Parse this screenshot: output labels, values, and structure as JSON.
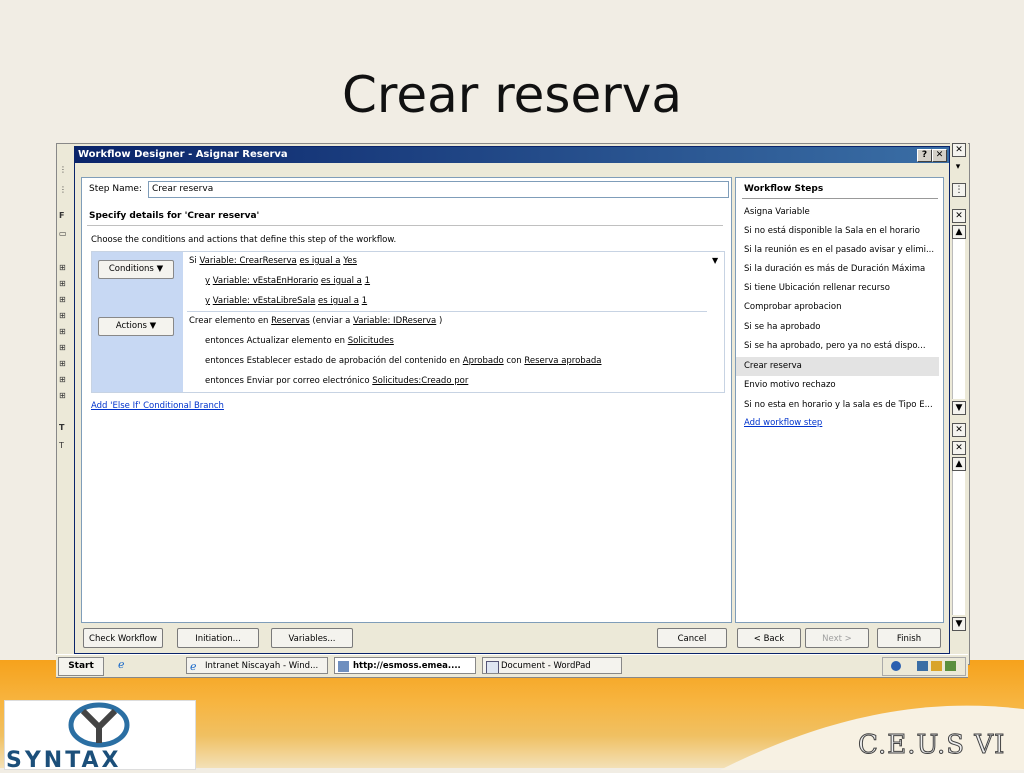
{
  "slide": {
    "title": "Crear reserva"
  },
  "dialog": {
    "title": "Workflow Designer - Asignar Reserva",
    "help_btn": "?",
    "close_btn": "✕",
    "step_name_label": "Step Name:",
    "step_name_value": "Crear reserva",
    "section_heading": "Specify details for 'Crear reserva'",
    "instructions": "Choose the conditions and actions that define this step of the workflow.",
    "conditions_btn": "Conditions ▼",
    "actions_btn": "Actions ▼",
    "conditions": [
      {
        "prefix": "Si ",
        "var": "Variable: CrearReserva",
        "op": "es igual a",
        "val": "Yes"
      },
      {
        "prefix": "y",
        "var": "Variable: vEstaEnHorario",
        "op": "es igual a",
        "val": "1"
      },
      {
        "prefix": "y",
        "var": "Variable: vEstaLibreSala",
        "op": "es igual a",
        "val": "1"
      }
    ],
    "actions": [
      {
        "t1": "Crear elemento en ",
        "l1": "Reservas",
        "t2": " (enviar a ",
        "l2": "Variable: IDReserva",
        "t3": " )"
      },
      {
        "t1": "entonces Actualizar elemento en ",
        "l1": "Solicitudes"
      },
      {
        "t1": "entonces Establecer estado de aprobación del contenido en ",
        "l1": "Aprobado",
        "t2": " con ",
        "l2": "Reserva aprobada"
      },
      {
        "t1": "entonces Enviar por correo electrónico ",
        "l1": "Solicitudes:Creado por"
      }
    ],
    "else_branch_link": "Add 'Else If' Conditional Branch",
    "steps_title": "Workflow Steps",
    "steps": [
      "Asigna Variable",
      "Si no está disponible la Sala en el horario",
      "Si la reunión es en el pasado avisar y elimi...",
      "Si la duración es más de Duración Máxima",
      "Si tiene Ubicación rellenar recurso",
      "Comprobar aprobacion",
      "Si se ha aprobado",
      "Si se ha aprobado, pero ya no está dispo...",
      "Crear reserva",
      "Envio motivo rechazo",
      "Si no esta en horario y la sala es de Tipo E..."
    ],
    "selected_step_index": 8,
    "add_step_link": "Add workflow step",
    "buttons": {
      "check": "Check Workflow",
      "initiation": "Initiation...",
      "variables": "Variables...",
      "cancel": "Cancel",
      "back": "< Back",
      "next": "Next >",
      "finish": "Finish"
    }
  },
  "taskbar": {
    "start": "Start",
    "tasks": [
      "Intranet Niscayah - Wind...",
      "http://esmoss.emea....",
      "Document - WordPad"
    ]
  },
  "logos": {
    "syntax": "SYNTAX",
    "ceus": "C.E.U.S VI"
  }
}
